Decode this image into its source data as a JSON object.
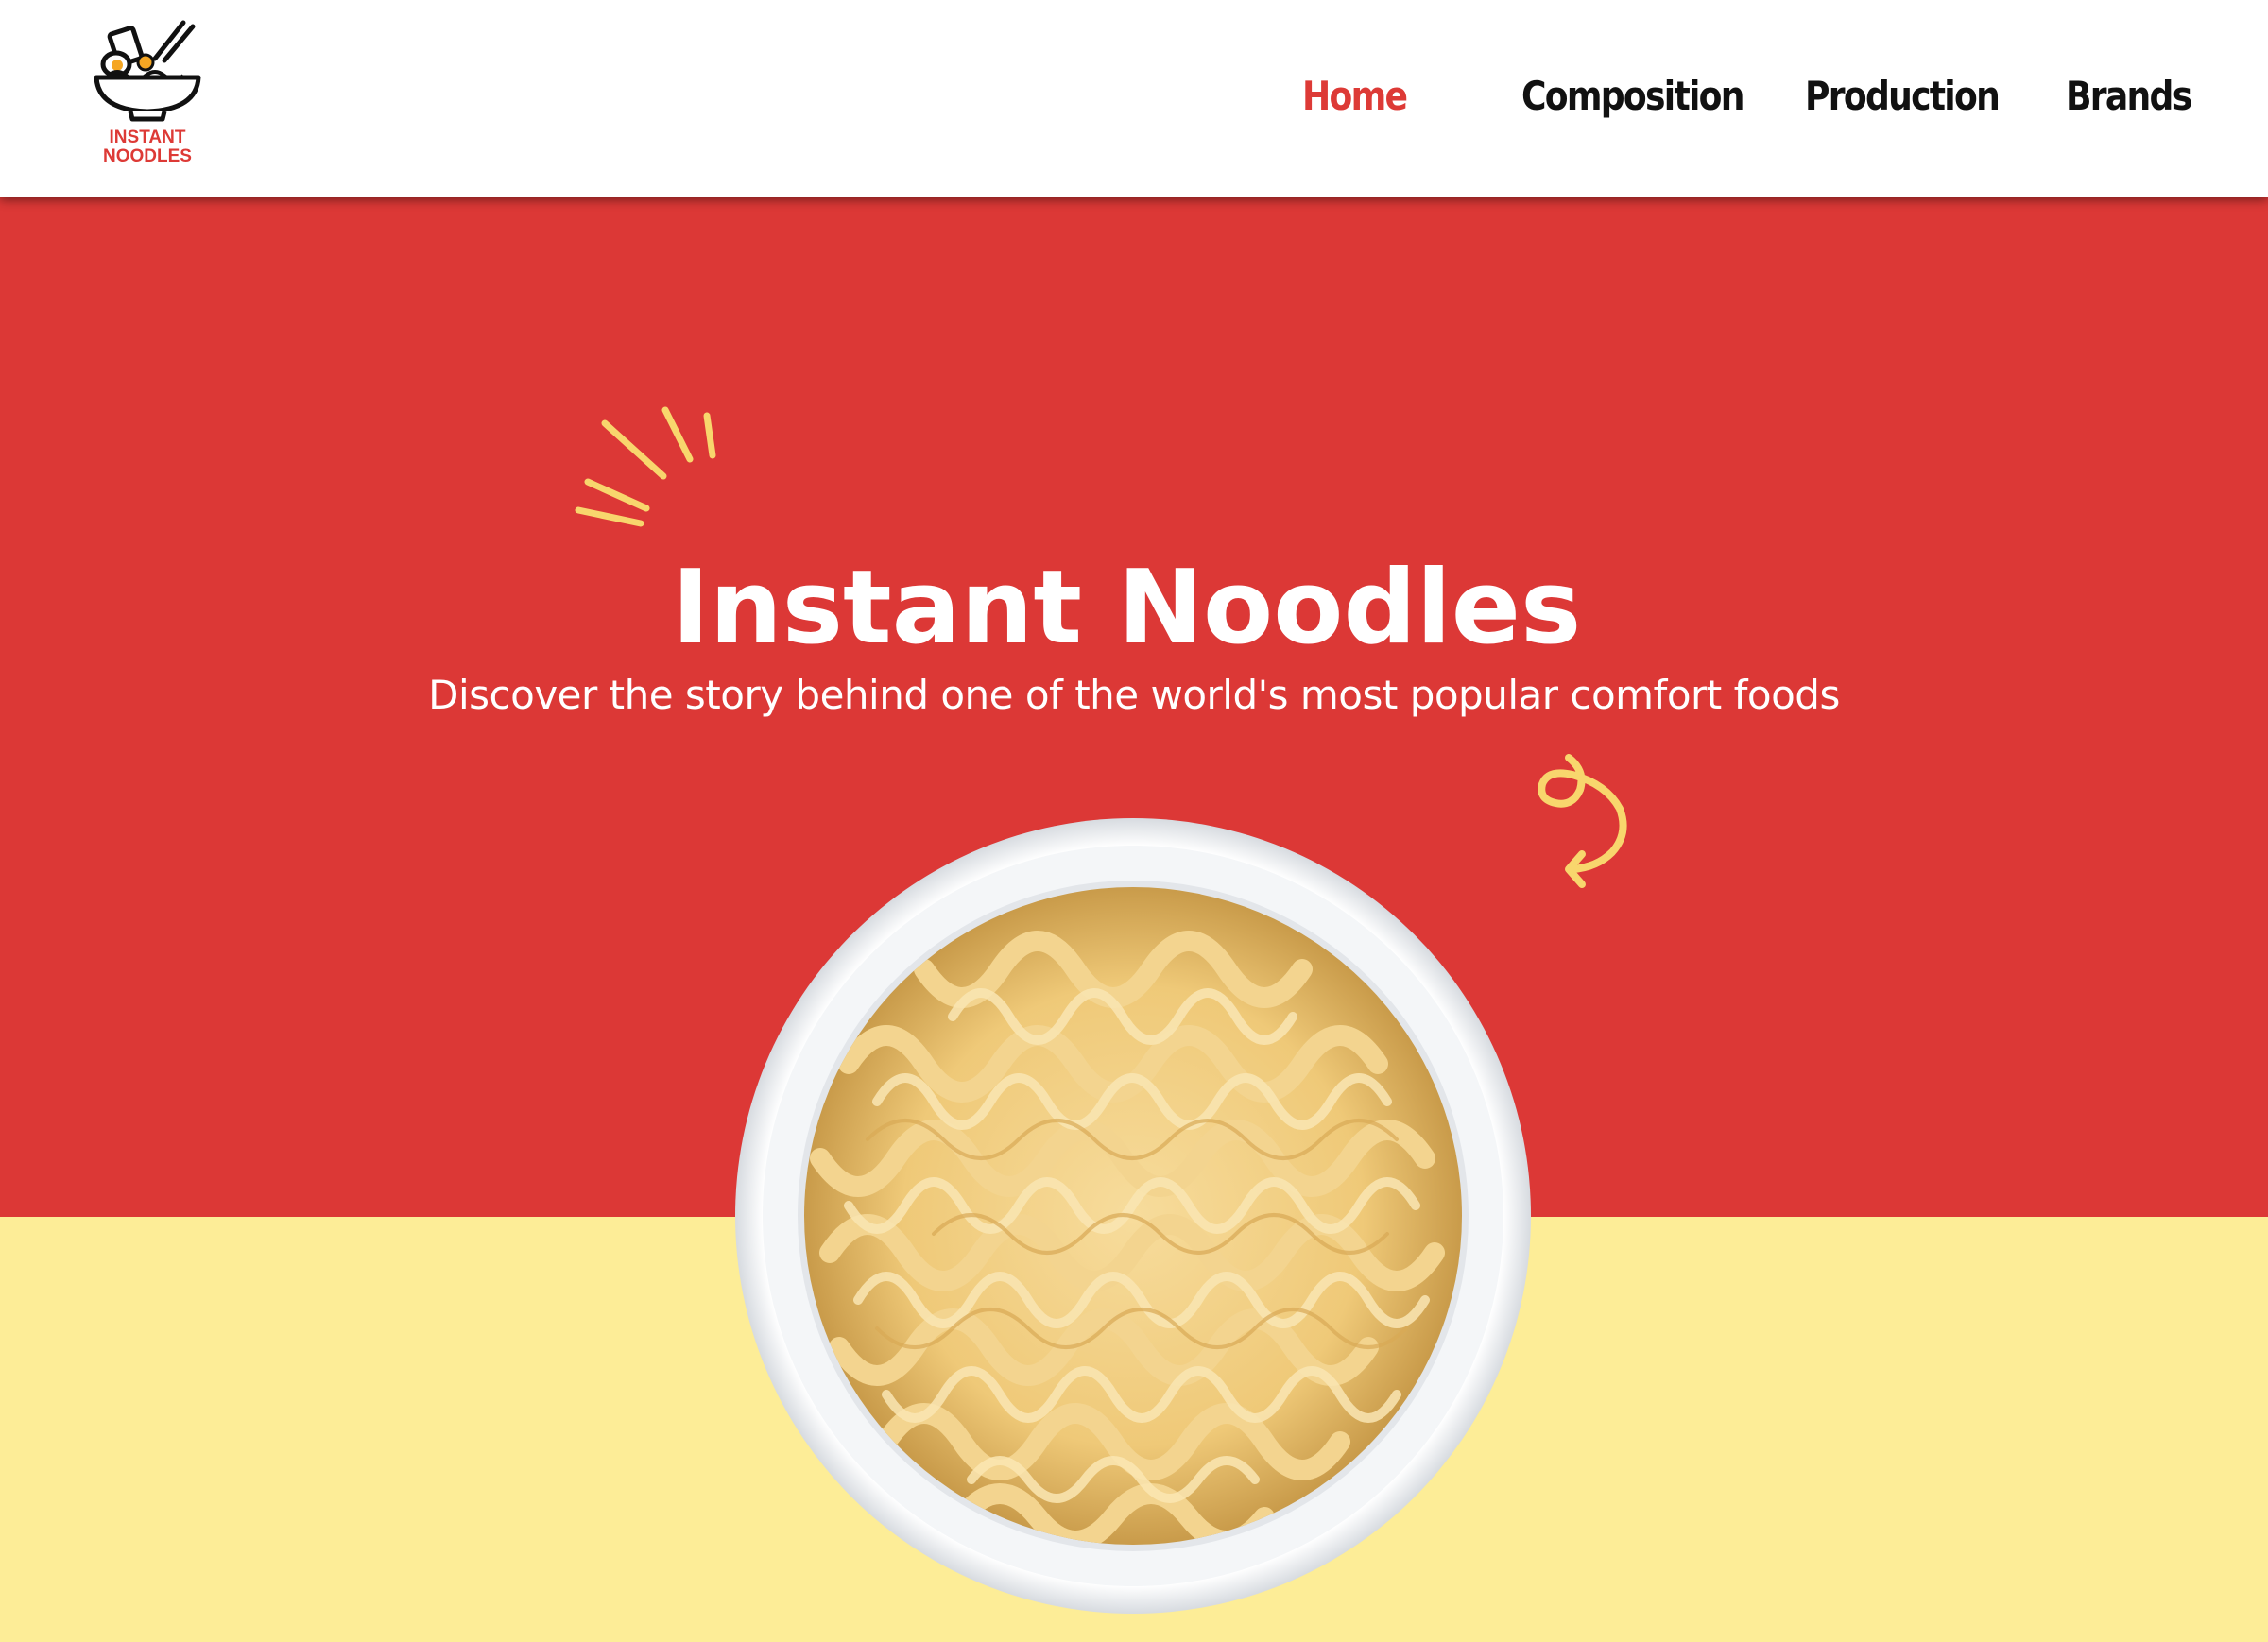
{
  "logo": {
    "line1": "INSTANT",
    "line2": "NOODLES",
    "icon": "noodle-bowl-icon"
  },
  "nav": {
    "items": [
      {
        "label": "Home",
        "active": true
      },
      {
        "label": "Composition",
        "active": false
      },
      {
        "label": "Production",
        "active": false
      },
      {
        "label": "Brands",
        "active": false
      }
    ]
  },
  "hero": {
    "title": "Instant Noodles",
    "subtitle": "Discover the story behind one of the world's most popular comfort foods",
    "decorations": [
      "sparkle-rays-icon",
      "curly-arrow-icon"
    ],
    "image": "noodle-bowl-photo"
  },
  "colors": {
    "brand_red": "#dc3836",
    "accent_yellow": "#fded97",
    "doodle_yellow": "#f8d66d",
    "nav_text": "#111111"
  }
}
